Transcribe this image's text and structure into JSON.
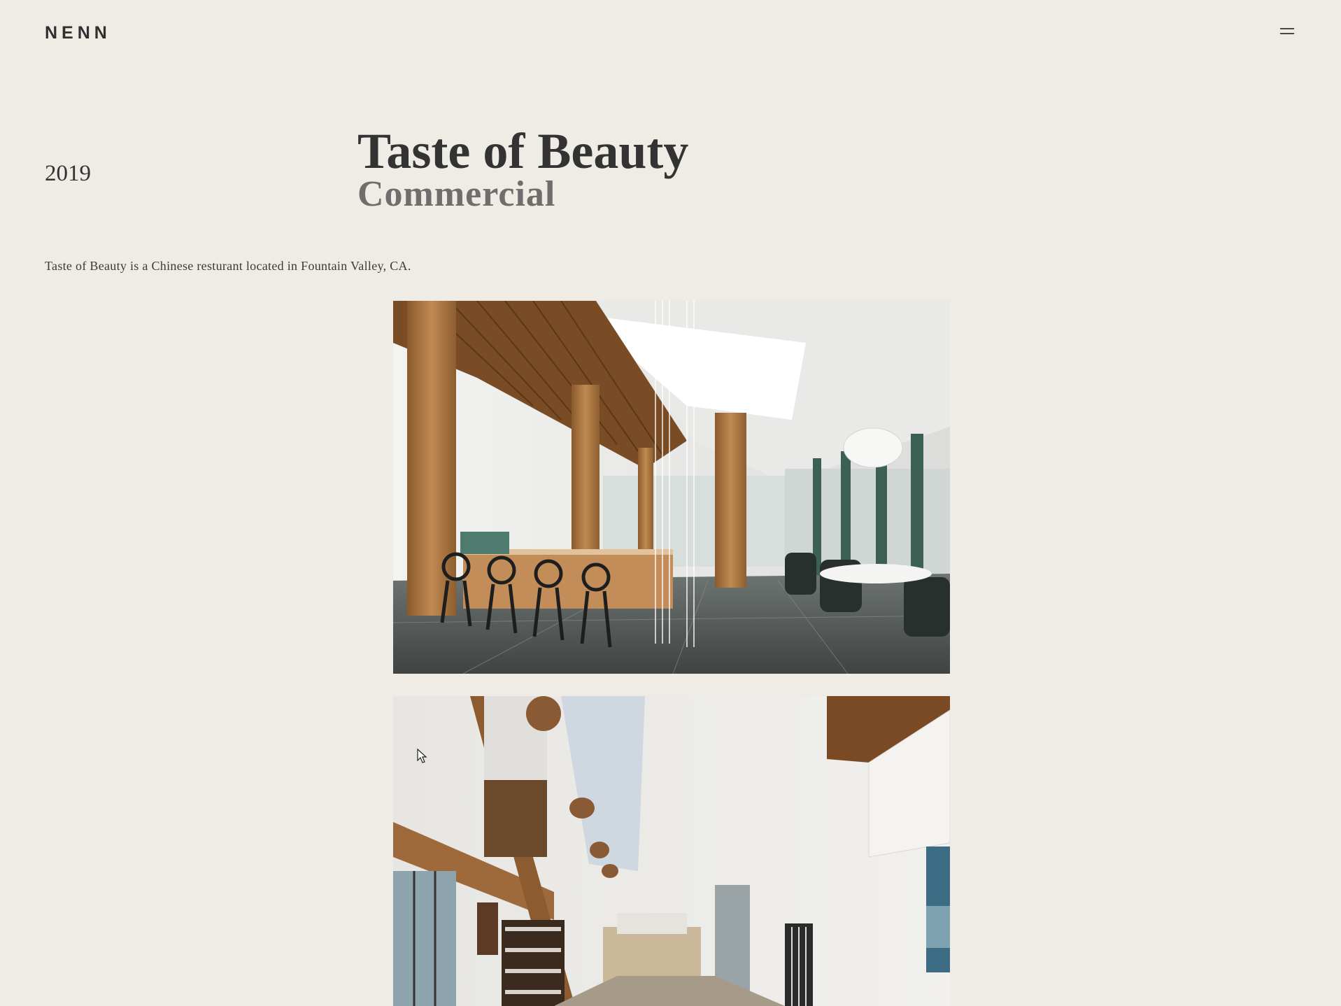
{
  "header": {
    "logo": "NENN",
    "menu_icon": "hamburger-icon"
  },
  "project": {
    "year": "2019",
    "title": "Taste of Beauty",
    "category": "Commercial",
    "description": "Taste of Beauty is a Chinese resturant located in Fountain Valley, CA."
  },
  "gallery": [
    {
      "name": "Restaurant interior rendering"
    },
    {
      "name": "Restaurant interior photo"
    }
  ],
  "colors": {
    "background": "#efece6",
    "text": "#333333",
    "subtitle": "#6f6e6c"
  }
}
